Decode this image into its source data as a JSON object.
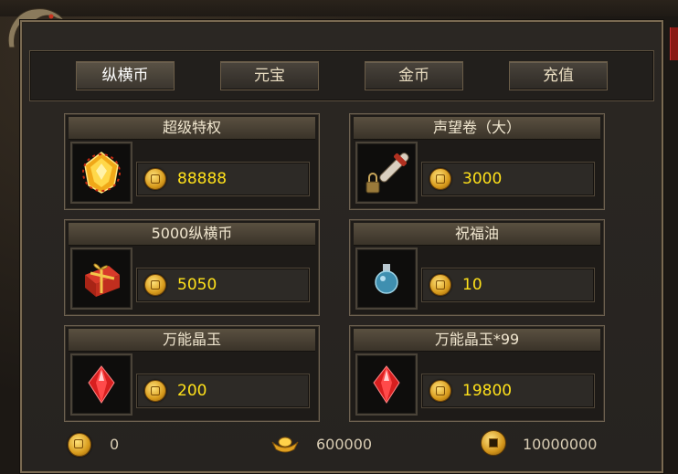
{
  "tabs": [
    {
      "label": "纵横币",
      "active": true
    },
    {
      "label": "元宝",
      "active": false
    },
    {
      "label": "金币",
      "active": false
    },
    {
      "label": "充值",
      "active": false
    }
  ],
  "items": [
    {
      "name": "超级特权",
      "price": "88888",
      "icon": "gold-gem-icon"
    },
    {
      "name": "声望卷（大）",
      "price": "3000",
      "icon": "scroll-icon"
    },
    {
      "name": "5000纵横币",
      "price": "5050",
      "icon": "gift-box-icon"
    },
    {
      "name": "祝福油",
      "price": "10",
      "icon": "potion-bottle-icon"
    },
    {
      "name": "万能晶玉",
      "price": "200",
      "icon": "red-crystal-icon"
    },
    {
      "name": "万能晶玉*99",
      "price": "19800",
      "icon": "red-crystal-icon"
    }
  ],
  "footer": {
    "zongheng_balance": "0",
    "yuanbao_balance": "600000",
    "gold_balance": "10000000"
  },
  "colors": {
    "price": "#ffe11a",
    "frame": "#7a6a52"
  }
}
